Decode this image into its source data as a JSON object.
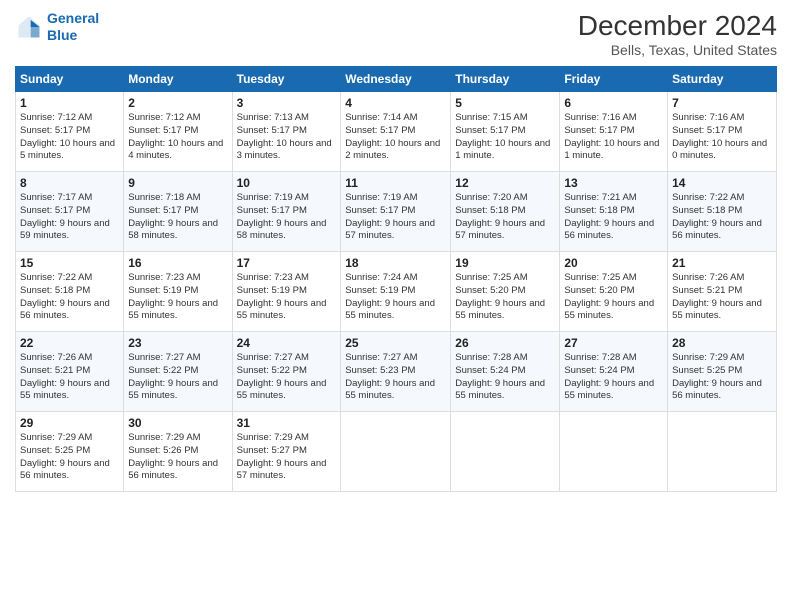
{
  "logo": {
    "line1": "General",
    "line2": "Blue"
  },
  "title": "December 2024",
  "subtitle": "Bells, Texas, United States",
  "days_of_week": [
    "Sunday",
    "Monday",
    "Tuesday",
    "Wednesday",
    "Thursday",
    "Friday",
    "Saturday"
  ],
  "weeks": [
    [
      {
        "day": "1",
        "sunrise": "7:12 AM",
        "sunset": "5:17 PM",
        "daylight": "10 hours and 5 minutes."
      },
      {
        "day": "2",
        "sunrise": "7:12 AM",
        "sunset": "5:17 PM",
        "daylight": "10 hours and 4 minutes."
      },
      {
        "day": "3",
        "sunrise": "7:13 AM",
        "sunset": "5:17 PM",
        "daylight": "10 hours and 3 minutes."
      },
      {
        "day": "4",
        "sunrise": "7:14 AM",
        "sunset": "5:17 PM",
        "daylight": "10 hours and 2 minutes."
      },
      {
        "day": "5",
        "sunrise": "7:15 AM",
        "sunset": "5:17 PM",
        "daylight": "10 hours and 1 minute."
      },
      {
        "day": "6",
        "sunrise": "7:16 AM",
        "sunset": "5:17 PM",
        "daylight": "10 hours and 1 minute."
      },
      {
        "day": "7",
        "sunrise": "7:16 AM",
        "sunset": "5:17 PM",
        "daylight": "10 hours and 0 minutes."
      }
    ],
    [
      {
        "day": "8",
        "sunrise": "7:17 AM",
        "sunset": "5:17 PM",
        "daylight": "9 hours and 59 minutes."
      },
      {
        "day": "9",
        "sunrise": "7:18 AM",
        "sunset": "5:17 PM",
        "daylight": "9 hours and 58 minutes."
      },
      {
        "day": "10",
        "sunrise": "7:19 AM",
        "sunset": "5:17 PM",
        "daylight": "9 hours and 58 minutes."
      },
      {
        "day": "11",
        "sunrise": "7:19 AM",
        "sunset": "5:17 PM",
        "daylight": "9 hours and 57 minutes."
      },
      {
        "day": "12",
        "sunrise": "7:20 AM",
        "sunset": "5:18 PM",
        "daylight": "9 hours and 57 minutes."
      },
      {
        "day": "13",
        "sunrise": "7:21 AM",
        "sunset": "5:18 PM",
        "daylight": "9 hours and 56 minutes."
      },
      {
        "day": "14",
        "sunrise": "7:22 AM",
        "sunset": "5:18 PM",
        "daylight": "9 hours and 56 minutes."
      }
    ],
    [
      {
        "day": "15",
        "sunrise": "7:22 AM",
        "sunset": "5:18 PM",
        "daylight": "9 hours and 56 minutes."
      },
      {
        "day": "16",
        "sunrise": "7:23 AM",
        "sunset": "5:19 PM",
        "daylight": "9 hours and 55 minutes."
      },
      {
        "day": "17",
        "sunrise": "7:23 AM",
        "sunset": "5:19 PM",
        "daylight": "9 hours and 55 minutes."
      },
      {
        "day": "18",
        "sunrise": "7:24 AM",
        "sunset": "5:19 PM",
        "daylight": "9 hours and 55 minutes."
      },
      {
        "day": "19",
        "sunrise": "7:25 AM",
        "sunset": "5:20 PM",
        "daylight": "9 hours and 55 minutes."
      },
      {
        "day": "20",
        "sunrise": "7:25 AM",
        "sunset": "5:20 PM",
        "daylight": "9 hours and 55 minutes."
      },
      {
        "day": "21",
        "sunrise": "7:26 AM",
        "sunset": "5:21 PM",
        "daylight": "9 hours and 55 minutes."
      }
    ],
    [
      {
        "day": "22",
        "sunrise": "7:26 AM",
        "sunset": "5:21 PM",
        "daylight": "9 hours and 55 minutes."
      },
      {
        "day": "23",
        "sunrise": "7:27 AM",
        "sunset": "5:22 PM",
        "daylight": "9 hours and 55 minutes."
      },
      {
        "day": "24",
        "sunrise": "7:27 AM",
        "sunset": "5:22 PM",
        "daylight": "9 hours and 55 minutes."
      },
      {
        "day": "25",
        "sunrise": "7:27 AM",
        "sunset": "5:23 PM",
        "daylight": "9 hours and 55 minutes."
      },
      {
        "day": "26",
        "sunrise": "7:28 AM",
        "sunset": "5:24 PM",
        "daylight": "9 hours and 55 minutes."
      },
      {
        "day": "27",
        "sunrise": "7:28 AM",
        "sunset": "5:24 PM",
        "daylight": "9 hours and 55 minutes."
      },
      {
        "day": "28",
        "sunrise": "7:29 AM",
        "sunset": "5:25 PM",
        "daylight": "9 hours and 56 minutes."
      }
    ],
    [
      {
        "day": "29",
        "sunrise": "7:29 AM",
        "sunset": "5:25 PM",
        "daylight": "9 hours and 56 minutes."
      },
      {
        "day": "30",
        "sunrise": "7:29 AM",
        "sunset": "5:26 PM",
        "daylight": "9 hours and 56 minutes."
      },
      {
        "day": "31",
        "sunrise": "7:29 AM",
        "sunset": "5:27 PM",
        "daylight": "9 hours and 57 minutes."
      },
      null,
      null,
      null,
      null
    ]
  ]
}
